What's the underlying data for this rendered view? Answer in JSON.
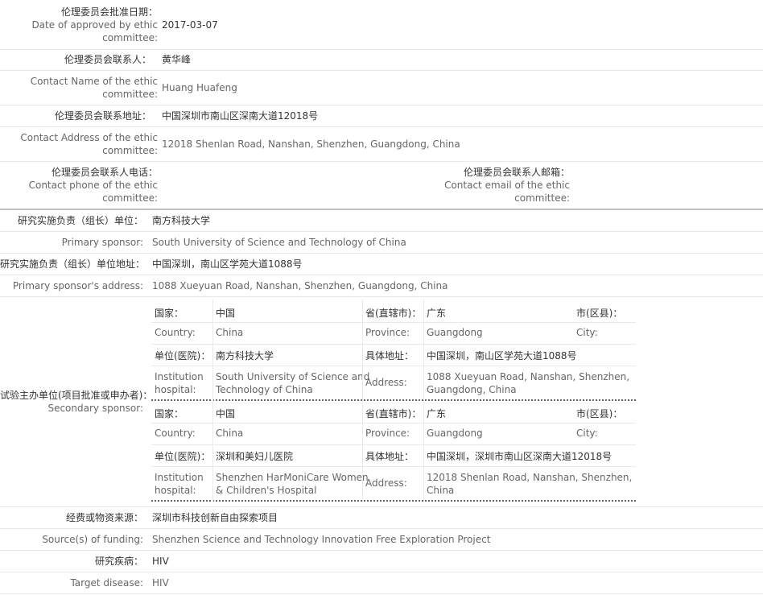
{
  "ethic": {
    "approved_date_label_zh": "伦理委员会批准日期：",
    "approved_date_label_en1": "Date of approved by ethic",
    "approved_date_label_en2": "committee:",
    "approved_date_value": "2017-03-07",
    "contact_name_label_zh": "伦理委员会联系人：",
    "contact_name_value_zh": "黄华峰",
    "contact_name_label_en1": "Contact Name of the ethic",
    "contact_name_label_en2": "committee:",
    "contact_name_value_en": "Huang Huafeng",
    "contact_address_label_zh": "伦理委员会联系地址：",
    "contact_address_value_zh": "中国深圳市南山区深南大道12018号",
    "contact_address_label_en1": "Contact Address of the ethic",
    "contact_address_label_en2": "committee:",
    "contact_address_value_en": "12018 Shenlan Road, Nanshan, Shenzhen, Guangdong, China",
    "phone_label_zh": "伦理委员会联系人电话：",
    "phone_label_en1": "Contact phone of the ethic",
    "phone_label_en2": "committee:",
    "email_label_zh": "伦理委员会联系人邮箱：",
    "email_label_en1": "Contact email of the ethic",
    "email_label_en2": "committee:"
  },
  "sponsor": {
    "primary_label_zh": "研究实施负责（组长）单位：",
    "primary_value_zh": "南方科技大学",
    "primary_label_en": "Primary sponsor:",
    "primary_value_en": "South University of Science and Technology of China",
    "primary_address_label_zh": "研究实施负责（组长）单位地址：",
    "primary_address_value_zh": "中国深圳，南山区学苑大道1088号",
    "primary_address_label_en": "Primary sponsor's address:",
    "primary_address_value_en": "1088 Xueyuan Road, Nanshan, Shenzhen, Guangdong, China",
    "secondary_label_zh": "试验主办单位(项目批准或申办者)：",
    "secondary_label_en": "Secondary sponsor:",
    "secondary": [
      {
        "country_label_zh": "国家：",
        "country_zh": "中国",
        "province_label_zh": "省(直辖市)：",
        "province_zh": "广东",
        "city_label_zh": "市(区县)：",
        "country_label_en": "Country:",
        "country_en": "China",
        "province_label_en": "Province:",
        "province_en": "Guangdong",
        "city_label_en": "City:",
        "inst_label_zh": "单位(医院)：",
        "inst_zh": "南方科技大学",
        "addr_label_zh": "具体地址：",
        "addr_zh": "中国深圳，南山区学苑大道1088号",
        "inst_label_en1": "Institution",
        "inst_label_en2": "hospital:",
        "inst_en1": "South University of Science and",
        "inst_en2": "Technology of China",
        "addr_label_en": "Address:",
        "addr_en1": "1088 Xueyuan Road, Nanshan, Shenzhen,",
        "addr_en2": "Guangdong, China"
      },
      {
        "country_label_zh": "国家：",
        "country_zh": "中国",
        "province_label_zh": "省(直辖市)：",
        "province_zh": "广东",
        "city_label_zh": "市(区县)：",
        "country_label_en": "Country:",
        "country_en": "China",
        "province_label_en": "Province:",
        "province_en": "Guangdong",
        "city_label_en": "City:",
        "inst_label_zh": "单位(医院)：",
        "inst_zh": "深圳和美妇儿医院",
        "addr_label_zh": "具体地址：",
        "addr_zh": "中国深圳，深圳市南山区深南大道12018号",
        "inst_label_en1": "Institution",
        "inst_label_en2": "hospital:",
        "inst_en1": "Shenzhen HarMoniCare Women",
        "inst_en2": "& Children's Hospital",
        "addr_label_en": "Address:",
        "addr_en1": "12018 Shenlan Road, Nanshan, Shenzhen,",
        "addr_en2": "China"
      }
    ]
  },
  "funding": {
    "label_zh": "经费或物资来源：",
    "value_zh": "深圳市科技创新自由探索项目",
    "label_en": "Source(s) of funding:",
    "value_en": "Shenzhen Science and Technology Innovation Free Exploration Project"
  },
  "disease": {
    "label_zh": "研究疾病：",
    "value_zh": "HIV",
    "label_en": "Target disease:",
    "value_en": "HIV"
  }
}
